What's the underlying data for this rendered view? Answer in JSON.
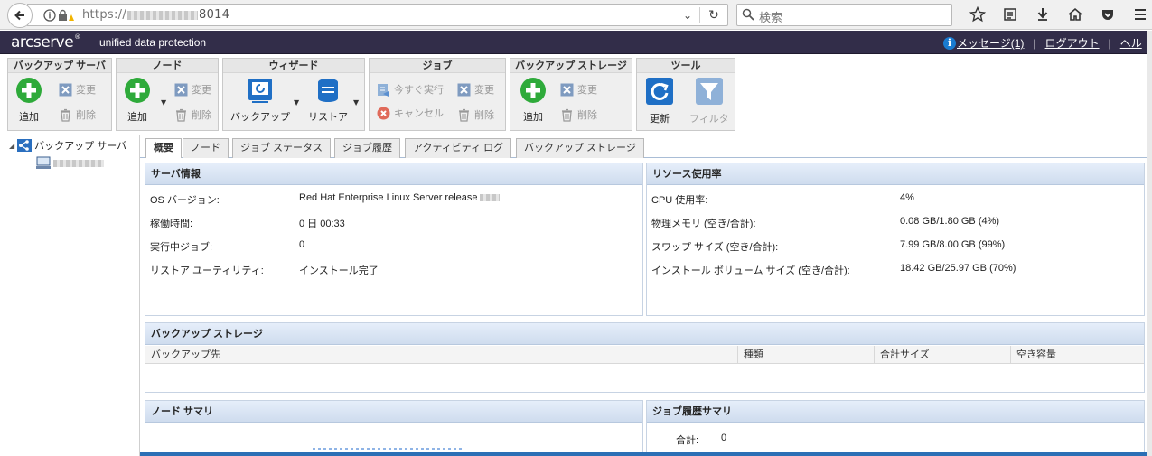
{
  "browser": {
    "url_prefix": "https://",
    "url_port": "8014",
    "search_placeholder": "検索"
  },
  "header": {
    "logo": "arcserve",
    "product": "unified data protection",
    "messages": "メッセージ(1)",
    "logout": "ログアウト",
    "help": "ヘル"
  },
  "ribbon": {
    "backup_server": {
      "title": "バックアップ サーバ",
      "add": "追加",
      "modify": "変更",
      "delete": "削除"
    },
    "node": {
      "title": "ノード",
      "add": "追加",
      "modify": "変更",
      "delete": "削除"
    },
    "wizard": {
      "title": "ウィザード",
      "backup": "バックアップ",
      "restore": "リストア"
    },
    "job": {
      "title": "ジョブ",
      "run_now": "今すぐ実行",
      "modify": "変更",
      "cancel": "キャンセル",
      "delete": "削除"
    },
    "backup_storage": {
      "title": "バックアップ ストレージ",
      "add": "追加",
      "modify": "変更",
      "delete": "削除"
    },
    "tools": {
      "title": "ツール",
      "refresh": "更新",
      "filter": "フィルタ"
    }
  },
  "tree": {
    "root": "バックアップ サーバ"
  },
  "tabs": [
    "概要",
    "ノード",
    "ジョブ ステータス",
    "ジョブ履歴",
    "アクティビティ ログ",
    "バックアップ ストレージ"
  ],
  "server_info": {
    "title": "サーバ情報",
    "rows": [
      {
        "label": "OS バージョン:",
        "value": "Red Hat Enterprise Linux Server release"
      },
      {
        "label": "稼働時間:",
        "value": "0 日 00:33"
      },
      {
        "label": "実行中ジョブ:",
        "value": "0"
      },
      {
        "label": "リストア ユーティリティ:",
        "value": "インストール完了"
      }
    ]
  },
  "resource_usage": {
    "title": "リソース使用率",
    "rows": [
      {
        "label": "CPU 使用率:",
        "value": "4%"
      },
      {
        "label": "物理メモリ (空き/合計):",
        "value": "0.08 GB/1.80 GB (4%)"
      },
      {
        "label": "スワップ サイズ (空き/合計):",
        "value": "7.99 GB/8.00 GB (99%)"
      },
      {
        "label": "インストール ボリューム サイズ (空き/合計):",
        "value": "18.42 GB/25.97 GB (70%)"
      }
    ]
  },
  "backup_storage": {
    "title": "バックアップ ストレージ",
    "columns": [
      "バックアップ先",
      "種類",
      "合計サイズ",
      "空き容量"
    ]
  },
  "node_summary": {
    "title": "ノード サマリ"
  },
  "job_history_summary": {
    "title": "ジョブ履歴サマリ",
    "total_label": "合計:",
    "total_value": "0"
  },
  "colors": {
    "header_bg": "#322d49",
    "accent_blue": "#1a7bd0",
    "add_green": "#2eaa3a",
    "panel_head": "#d9e4f3"
  }
}
